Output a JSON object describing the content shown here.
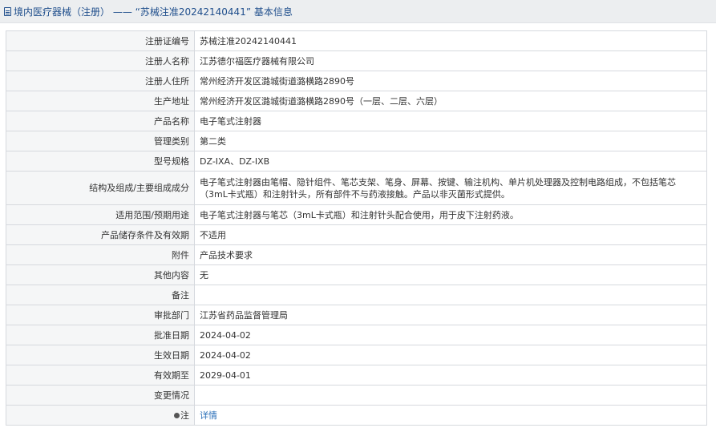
{
  "header": {
    "title": "境内医疗器械（注册） —— “苏械注准20242140441” 基本信息"
  },
  "rows": [
    {
      "label": "注册证编号",
      "value": "苏械注准20242140441"
    },
    {
      "label": "注册人名称",
      "value": "江苏德尔福医疗器械有限公司"
    },
    {
      "label": "注册人住所",
      "value": "常州经济开发区潞城街道潞横路2890号"
    },
    {
      "label": "生产地址",
      "value": "常州经济开发区潞城街道潞横路2890号（一层、二层、六层）"
    },
    {
      "label": "产品名称",
      "value": "电子笔式注射器"
    },
    {
      "label": "管理类别",
      "value": "第二类"
    },
    {
      "label": "型号规格",
      "value": "DZ-IXA、DZ-IXB"
    },
    {
      "label": "结构及组成/主要组成成分",
      "value": "电子笔式注射器由笔帽、隐针组件、笔芯支架、笔身、屏幕、按键、输注机构、单片机处理器及控制电路组成，不包括笔芯（3mL卡式瓶）和注射针头，所有部件不与药液接触。产品以非灭菌形式提供。"
    },
    {
      "label": "适用范围/预期用途",
      "value": "电子笔式注射器与笔芯（3mL卡式瓶）和注射针头配合使用，用于皮下注射药液。"
    },
    {
      "label": "产品储存条件及有效期",
      "value": "不适用"
    },
    {
      "label": "附件",
      "value": "产品技术要求"
    },
    {
      "label": "其他内容",
      "value": "无"
    },
    {
      "label": "备注",
      "value": ""
    },
    {
      "label": "审批部门",
      "value": "江苏省药品监督管理局"
    },
    {
      "label": "批准日期",
      "value": "2024-04-02"
    },
    {
      "label": "生效日期",
      "value": "2024-04-02"
    },
    {
      "label": "有效期至",
      "value": "2029-04-01"
    },
    {
      "label": "变更情况",
      "value": ""
    }
  ],
  "note": {
    "label": "注",
    "link": "详情"
  }
}
